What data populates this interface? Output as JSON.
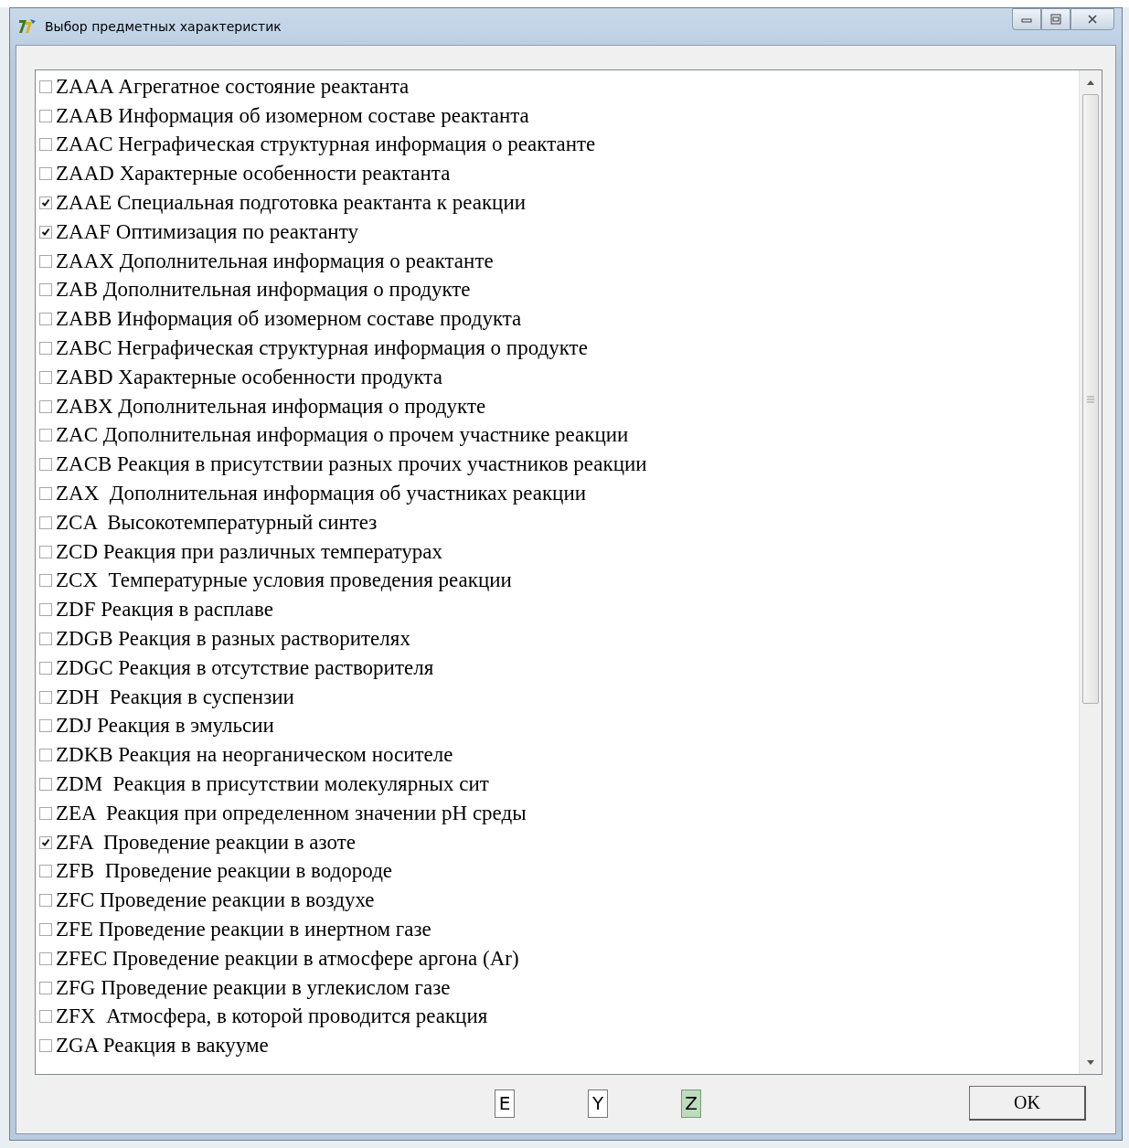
{
  "window": {
    "title": "Выбор предметных характеристик"
  },
  "items": [
    {
      "label": "ZAAA Агрегатное состояние реактанта",
      "checked": false
    },
    {
      "label": "ZAAB Информация об изомерном составе реактанта",
      "checked": false
    },
    {
      "label": "ZAAC Неграфическая структурная информация о реактанте",
      "checked": false
    },
    {
      "label": "ZAAD Характерные особенности реактанта",
      "checked": false
    },
    {
      "label": "ZAAE Специальная подготовка реактанта к реакции",
      "checked": true
    },
    {
      "label": "ZAAF Оптимизация по реактанту",
      "checked": true
    },
    {
      "label": "ZAAX Дополнительная информация о реактанте",
      "checked": false
    },
    {
      "label": "ZAB Дополнительная информация о продукте",
      "checked": false
    },
    {
      "label": "ZABB Информация об изомерном составе продукта",
      "checked": false
    },
    {
      "label": "ZABC Неграфическая структурная информация о продукте",
      "checked": false
    },
    {
      "label": "ZABD Характерные особенности продукта",
      "checked": false
    },
    {
      "label": "ZABX Дополнительная информация о продукте",
      "checked": false
    },
    {
      "label": "ZAC Дополнительная информация о прочем участнике реакции",
      "checked": false
    },
    {
      "label": "ZACB Реакция в присутствии разных прочих участников реакции",
      "checked": false
    },
    {
      "label": "ZAX  Дополнительная информация об участниках реакции",
      "checked": false
    },
    {
      "label": "ZCA  Высокотемпературный синтез",
      "checked": false
    },
    {
      "label": "ZCD Реакция при различных температурах",
      "checked": false
    },
    {
      "label": "ZCX  Температурные условия проведения реакции",
      "checked": false
    },
    {
      "label": "ZDF Реакция в расплаве",
      "checked": false
    },
    {
      "label": "ZDGB Реакция в разных растворителях",
      "checked": false
    },
    {
      "label": "ZDGC Реакция в отсутствие растворителя",
      "checked": false
    },
    {
      "label": "ZDH  Реакция в суспензии",
      "checked": false
    },
    {
      "label": "ZDJ Реакция в эмульсии",
      "checked": false
    },
    {
      "label": "ZDKB Реакция на неорганическом носителе",
      "checked": false
    },
    {
      "label": "ZDM  Реакция в присутствии молекулярных сит",
      "checked": false
    },
    {
      "label": "ZEA  Реакция при определенном значении pH среды",
      "checked": false
    },
    {
      "label": "ZFA  Проведение реакции в азоте",
      "checked": true
    },
    {
      "label": "ZFB  Проведение реакции в водороде",
      "checked": false
    },
    {
      "label": "ZFC Проведение реакции в воздухе",
      "checked": false
    },
    {
      "label": "ZFE Проведение реакции в инертном газе",
      "checked": false
    },
    {
      "label": "ZFEC Проведение реакции в атмосфере аргона (Ar)",
      "checked": false
    },
    {
      "label": "ZFG Проведение реакции в углекислом газе",
      "checked": false
    },
    {
      "label": "ZFX  Атмосфера, в которой проводится реакция",
      "checked": false
    },
    {
      "label": "ZGA Реакция в вакууме",
      "checked": false
    }
  ],
  "filters": [
    {
      "label": "E",
      "selected": false
    },
    {
      "label": "Y",
      "selected": false
    },
    {
      "label": "Z",
      "selected": true
    }
  ],
  "ok_button": {
    "label": "OK"
  }
}
